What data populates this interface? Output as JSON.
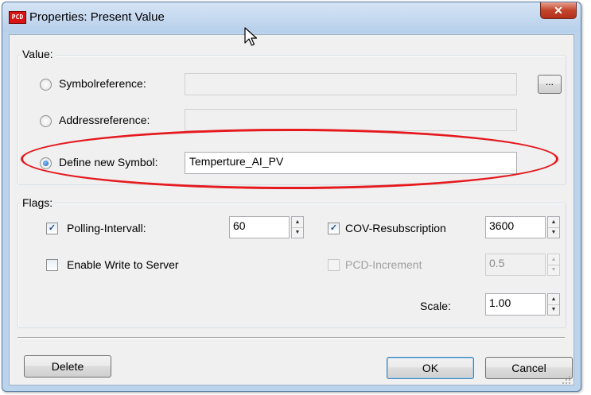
{
  "window": {
    "icon_text": "PCD",
    "title": "Properties: Present Value",
    "close_glyph": "✕"
  },
  "value_group": {
    "legend": "Value:",
    "symbolreference_label": "Symbolreference:",
    "symbolreference_value": "",
    "browse_label": "...",
    "addressreference_label": "Addressreference:",
    "addressreference_value": "",
    "define_new_label": "Define new Symbol:",
    "define_new_value": "Temperture_AI_PV",
    "selected": "define_new"
  },
  "flags_group": {
    "legend": "Flags:",
    "polling_label": "Polling-Intervall:",
    "polling_checked": true,
    "polling_value": "60",
    "cov_label": "COV-Resubscription",
    "cov_checked": true,
    "cov_value": "3600",
    "enable_write_label": "Enable Write to Server",
    "enable_write_checked": false,
    "pcd_increment_label": "PCD-Increment",
    "pcd_increment_checked": false,
    "pcd_increment_value": "0.5",
    "scale_label": "Scale:",
    "scale_value": "1.00"
  },
  "buttons": {
    "delete": "Delete",
    "ok": "OK",
    "cancel": "Cancel"
  },
  "colors": {
    "highlight_ellipse": "#e5191e",
    "title_bar": "#c4d9f0"
  }
}
